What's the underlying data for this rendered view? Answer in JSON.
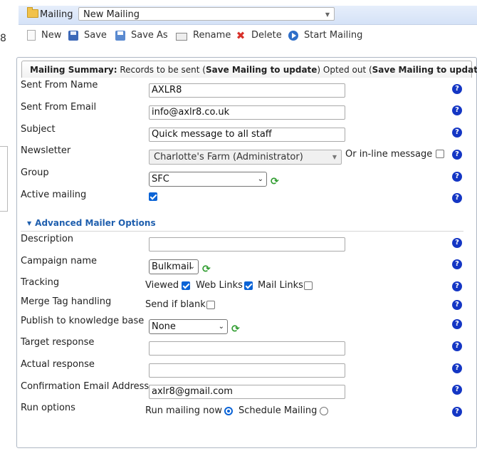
{
  "left_fragment": "8",
  "title_bar": {
    "label": "Mailing",
    "selected_mailing": "New Mailing"
  },
  "toolbar": {
    "new": "New",
    "save": "Save",
    "save_as": "Save As",
    "rename": "Rename",
    "delete": "Delete",
    "start": "Start Mailing"
  },
  "summary": {
    "prefix": "Mailing Summary:",
    "records_text": " Records to be sent (",
    "records_value": "Save Mailing to update",
    "opted_text": ") Opted out (",
    "opted_value": "Save Mailing to update",
    "suffix": ")"
  },
  "form": {
    "sent_from_name": {
      "label": "Sent From Name",
      "value": "AXLR8"
    },
    "sent_from_email": {
      "label": "Sent From Email",
      "value": "info@axlr8.co.uk"
    },
    "subject": {
      "label": "Subject",
      "value": "Quick message to all staff"
    },
    "newsletter": {
      "label": "Newsletter",
      "value": "Charlotte's Farm (Administrator)",
      "inline_label": "Or in-line message",
      "inline_checked": false
    },
    "group": {
      "label": "Group",
      "value": "SFC"
    },
    "active": {
      "label": "Active mailing",
      "checked": true
    }
  },
  "advanced": {
    "header": "Advanced Mailer Options",
    "description": {
      "label": "Description",
      "value": ""
    },
    "campaign": {
      "label": "Campaign name",
      "value": "Bulkmail"
    },
    "tracking": {
      "label": "Tracking",
      "viewed": "Viewed",
      "viewed_checked": true,
      "web_links": "Web Links",
      "web_links_checked": true,
      "mail_links": "Mail Links",
      "mail_links_checked": false
    },
    "merge": {
      "label": "Merge Tag handling",
      "send_if_blank": "Send if blank",
      "checked": false
    },
    "publish": {
      "label": "Publish to knowledge base",
      "value": "None"
    },
    "target": {
      "label": "Target response",
      "value": ""
    },
    "actual": {
      "label": "Actual response",
      "value": ""
    },
    "confirmation": {
      "label": "Confirmation Email Address",
      "value": "axlr8@gmail.com"
    },
    "run": {
      "label": "Run options",
      "run_now": "Run mailing now",
      "schedule": "Schedule Mailing",
      "selected": "run_now"
    }
  },
  "help_glyph": "?"
}
